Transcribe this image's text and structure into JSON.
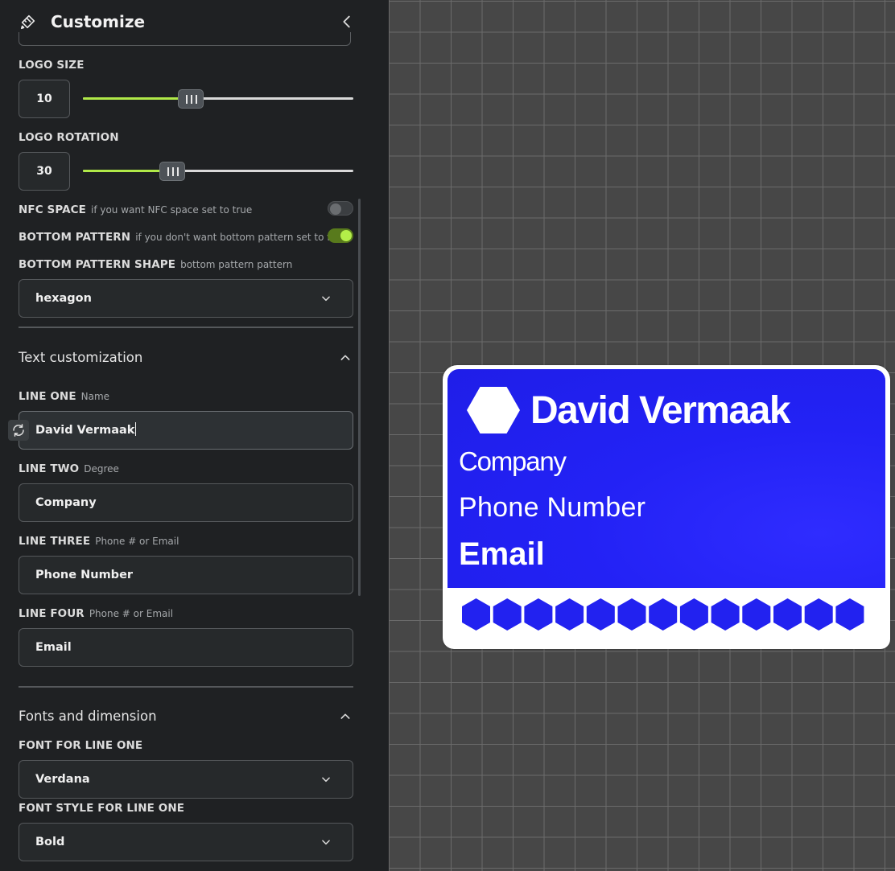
{
  "sidebar": {
    "title": "Customize",
    "logo_size": {
      "label": "LOGO SIZE",
      "value": "10",
      "slider_fraction": 0.4
    },
    "logo_rotation": {
      "label": "LOGO ROTATION",
      "value": "30",
      "slider_fraction": 0.33
    },
    "nfc_space": {
      "label": "NFC SPACE",
      "hint": "if you want NFC space set to true",
      "enabled": false
    },
    "bottom_pattern": {
      "label": "BOTTOM PATTERN",
      "hint": "if you don't want bottom pattern set to false",
      "enabled": true
    },
    "bottom_pattern_shape": {
      "label": "BOTTOM PATTERN SHAPE",
      "hint": "bottom pattern pattern",
      "value": "hexagon"
    },
    "text_section": {
      "title": "Text customization",
      "line_one": {
        "label": "LINE ONE",
        "hint": "Name",
        "value": "David Vermaak"
      },
      "line_two": {
        "label": "LINE TWO",
        "hint": "Degree",
        "value": "Company"
      },
      "line_three": {
        "label": "LINE THREE",
        "hint": "Phone # or Email",
        "value": "Phone Number"
      },
      "line_four": {
        "label": "LINE FOUR",
        "hint": "Phone # or Email",
        "value": "Email"
      }
    },
    "fonts_section": {
      "title": "Fonts and dimension",
      "font_line_one": {
        "label": "FONT FOR LINE ONE",
        "value": "Verdana"
      },
      "font_style_line_one": {
        "label": "FONT STYLE FOR LINE ONE",
        "value": "Bold"
      }
    }
  },
  "card": {
    "line_one": "David Vermaak",
    "line_two": "Company",
    "line_three": "Phone Number",
    "line_four": "Email",
    "face_color": "#2222f0",
    "pattern_count": 13
  },
  "colors": {
    "accent": "#b0e948",
    "panel_bg": "#1f2123",
    "canvas_bg": "#474747",
    "card_blue": "#2222f0"
  }
}
